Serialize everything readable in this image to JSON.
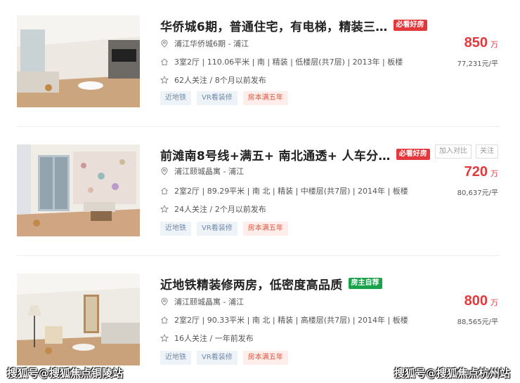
{
  "listings": [
    {
      "title": "华侨城6期，普通住宅，有电梯，精装三…",
      "tag": "必看好房",
      "community": "浦江华侨城6期 - 浦江",
      "details": "3室2厅 | 110.06平米 | 南 | 精装 | 低楼层(共7层) | 2013年 | 板楼",
      "followers": "62人关注 / 8个月以前发布",
      "badges": [
        "近地铁",
        "VR看装修",
        "房本满五年"
      ],
      "price": "850",
      "price_unit": "万",
      "unit_price": "77,231元/平"
    },
    {
      "title": "前滩南8号线+满五+ 南北通透+ 人车分…",
      "tag": "必看好房",
      "community": "浦江颐城晶寓 - 浦江",
      "details": "2室2厅 | 89.29平米 | 南 北 | 精装 | 中楼层(共7层) | 2014年 | 板楼",
      "followers": "24人关注 / 2个月以前发布",
      "badges": [
        "近地铁",
        "VR看装修",
        "房本满五年"
      ],
      "price": "720",
      "price_unit": "万",
      "unit_price": "80,637元/平",
      "actions": [
        "加入对比",
        "关注"
      ]
    },
    {
      "title": "近地铁精装修两房，低密度高品质",
      "tag": "房主自荐",
      "community": "浦江颐城晶寓 - 浦江",
      "details": "2室2厅 | 90.33平米 | 南 北 | 精装 | 高楼层(共7层) | 2014年 | 板楼",
      "followers": "16人关注 / 一年前发布",
      "badges": [
        "近地铁",
        "VR看装修",
        "房本满五年"
      ],
      "price": "800",
      "price_unit": "万",
      "unit_price": "88,565元/平"
    }
  ],
  "watermarks": {
    "left": "搜狐号@搜狐焦点铜陵站",
    "right": "搜狐号@搜狐焦点杭州站"
  },
  "icons": {
    "community": "location-pin-icon",
    "details": "house-icon",
    "followers": "star-icon"
  },
  "colors": {
    "price": "#e4393c",
    "tag_red": "#e4393c",
    "tag_green": "#1aa34a"
  }
}
